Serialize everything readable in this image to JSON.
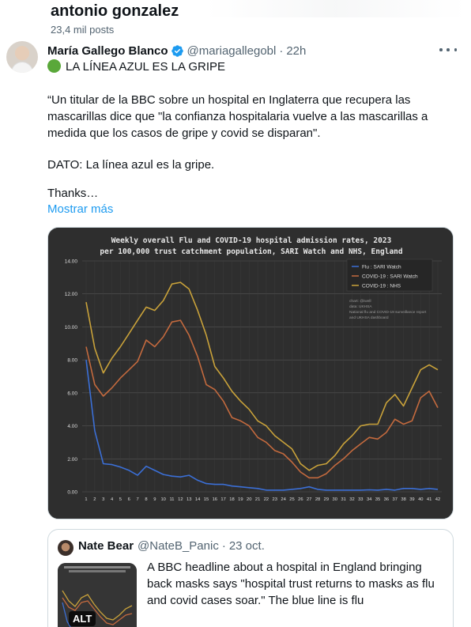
{
  "header": {
    "title": "antonio gonzalez",
    "subtitle": "23,4 mil posts"
  },
  "tweet": {
    "author_name": "María Gallego Blanco",
    "handle": "@mariagallegobl",
    "separator": "·",
    "time": "22h",
    "lines": [
      "LA LÍNEA AZUL ES LA GRIPE",
      "“Un titular de la BBC sobre un hospital en Inglaterra que recupera las",
      "mascarillas dice que \"la confianza hospitalaria vuelve a las mascarillas a",
      "medida que los casos de gripe y covid se disparan\".",
      "DATO: La línea azul es la gripe.",
      "Thanks…"
    ],
    "show_more": "Mostrar más"
  },
  "chart_data": {
    "type": "line",
    "title": "Weekly overall Flu and COVID-19 hospital admission rates, 2023",
    "subtitle": "per 100,000 trust catchment population, SARI Watch and NHS, England",
    "x": [
      1,
      2,
      3,
      4,
      5,
      6,
      7,
      8,
      9,
      10,
      11,
      12,
      13,
      14,
      15,
      16,
      17,
      18,
      19,
      20,
      21,
      22,
      23,
      24,
      25,
      26,
      27,
      28,
      29,
      30,
      31,
      32,
      33,
      34,
      35,
      36,
      37,
      38,
      39,
      40,
      41,
      42
    ],
    "ylim": [
      0,
      14
    ],
    "yticks": [
      "0.00",
      "2.00",
      "4.00",
      "6.00",
      "8.00",
      "10.00",
      "12.00",
      "14.00"
    ],
    "grid": true,
    "legend_position": "top-right",
    "annotations": [
      "chart: @iwell",
      "data: UKHSA",
      "National flu and COVID-19 surveillance report",
      "and UKHSA dashboard"
    ],
    "series": [
      {
        "name": "Flu : SARI Watch",
        "color": "#3b6fd6",
        "values": [
          8.0,
          3.7,
          1.7,
          1.65,
          1.5,
          1.3,
          1.0,
          1.55,
          1.3,
          1.05,
          0.95,
          0.9,
          1.0,
          0.7,
          0.5,
          0.45,
          0.45,
          0.35,
          0.3,
          0.25,
          0.2,
          0.1,
          0.1,
          0.1,
          0.15,
          0.2,
          0.3,
          0.15,
          0.1,
          0.1,
          0.1,
          0.1,
          0.1,
          0.12,
          0.1,
          0.15,
          0.1,
          0.2,
          0.2,
          0.15,
          0.2,
          0.15
        ]
      },
      {
        "name": "COVID-19 : SARI Watch",
        "color": "#c46a3e",
        "values": [
          8.8,
          6.5,
          5.8,
          6.3,
          6.9,
          7.4,
          7.9,
          9.2,
          8.8,
          9.4,
          10.3,
          10.4,
          9.5,
          8.2,
          6.5,
          6.2,
          5.5,
          4.5,
          4.3,
          4.0,
          3.3,
          3.0,
          2.5,
          2.3,
          1.8,
          1.2,
          0.85,
          0.85,
          1.1,
          1.6,
          2.0,
          2.5,
          2.9,
          3.3,
          3.2,
          3.6,
          4.4,
          4.1,
          4.3,
          5.7,
          6.1,
          5.1
        ]
      },
      {
        "name": "COVID-19 : NHS",
        "color": "#c9a23a",
        "values": [
          11.5,
          8.7,
          7.2,
          8.1,
          8.8,
          9.6,
          10.4,
          11.2,
          11.0,
          11.6,
          12.6,
          12.7,
          12.3,
          11.0,
          9.5,
          7.6,
          6.9,
          6.1,
          5.5,
          5.0,
          4.3,
          4.0,
          3.4,
          3.0,
          2.6,
          1.7,
          1.3,
          1.6,
          1.7,
          2.2,
          2.9,
          3.4,
          4.0,
          4.1,
          4.1,
          5.4,
          5.9,
          5.2,
          6.3,
          7.4,
          7.7,
          7.4
        ]
      }
    ]
  },
  "quote": {
    "author_name": "Nate Bear",
    "handle": "@NateB_Panic",
    "separator": "·",
    "time": "23 oct.",
    "text": "A BBC headline about a hospital in England bringing back masks says \"hospital trust returns to masks as flu and covid cases soar.\" The blue line is flu",
    "alt_label": "ALT"
  }
}
